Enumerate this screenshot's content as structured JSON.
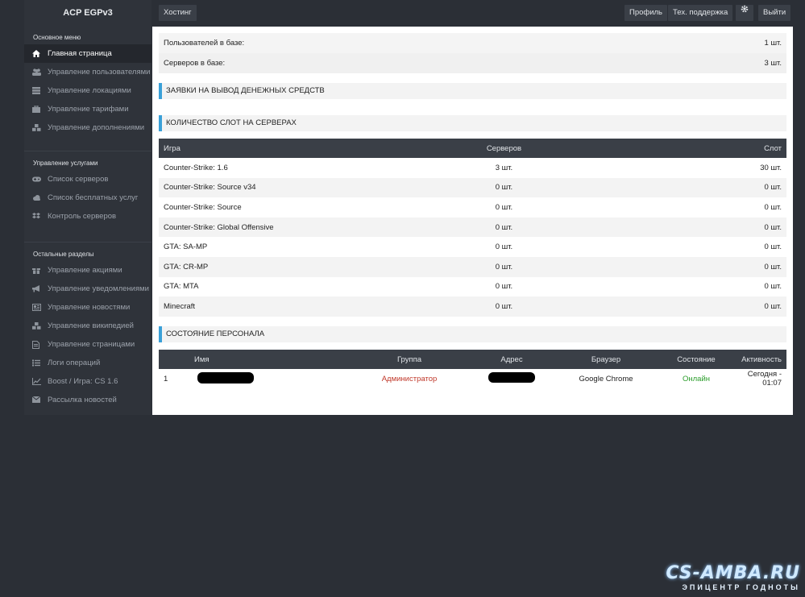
{
  "sidebar": {
    "brand": "ACP EGPv3",
    "sections": [
      {
        "title": "Основное меню",
        "items": [
          {
            "label": "Главная страница",
            "icon": "home-icon"
          },
          {
            "label": "Управление пользователями",
            "icon": "users-icon"
          },
          {
            "label": "Управление локациями",
            "icon": "server-rack-icon"
          },
          {
            "label": "Управление тарифами",
            "icon": "briefcase-icon"
          },
          {
            "label": "Управление дополнениями",
            "icon": "cubes-icon"
          }
        ]
      },
      {
        "title": "Управление услугами",
        "items": [
          {
            "label": "Список серверов",
            "icon": "gamepad-icon"
          },
          {
            "label": "Список бесплатных услуг",
            "icon": "cloud-icon"
          },
          {
            "label": "Контроль серверов",
            "icon": "dropbox-icon"
          }
        ]
      },
      {
        "title": "Остальные разделы",
        "items": [
          {
            "label": "Управление акциями",
            "icon": "gift-icon"
          },
          {
            "label": "Управление уведомлениями",
            "icon": "bullhorn-icon"
          },
          {
            "label": "Управление новостями",
            "icon": "newspaper-icon"
          },
          {
            "label": "Управление википедией",
            "icon": "cubes-icon"
          },
          {
            "label": "Управление страницами",
            "icon": "file-icon"
          },
          {
            "label": "Логи операций",
            "icon": "list-icon"
          },
          {
            "label": "Boost / Игра: CS 1.6",
            "icon": "line-chart-icon"
          },
          {
            "label": "Рассылка новостей",
            "icon": "mail-icon"
          }
        ]
      }
    ]
  },
  "topbar": {
    "hosting": "Хостинг",
    "profile": "Профиль",
    "support": "Тех. поддержка",
    "settings_icon": "gear-icon",
    "logout": "Выйти"
  },
  "stats": {
    "users_label": "Пользователей в базе:",
    "users_value": "1 шт.",
    "servers_label": "Серверов в базе:",
    "servers_value": "3 шт."
  },
  "headings": {
    "withdraw": "ЗАЯВКИ НА ВЫВОД ДЕНЕЖНЫХ СРЕДСТВ",
    "slots": "КОЛИЧЕСТВО СЛОТ НА СЕРВЕРАХ",
    "staff": "СОСТОЯНИЕ ПЕРСОНАЛА"
  },
  "slots_table": {
    "headers": {
      "game": "Игра",
      "servers": "Серверов",
      "slots": "Слот"
    },
    "rows": [
      {
        "game": "Counter-Strike: 1.6",
        "servers": "3 шт.",
        "slots": "30 шт."
      },
      {
        "game": "Counter-Strike: Source v34",
        "servers": "0 шт.",
        "slots": "0 шт."
      },
      {
        "game": "Counter-Strike: Source",
        "servers": "0 шт.",
        "slots": "0 шт."
      },
      {
        "game": "Counter-Strike: Global Offensive",
        "servers": "0 шт.",
        "slots": "0 шт."
      },
      {
        "game": "GTA: SA-MP",
        "servers": "0 шт.",
        "slots": "0 шт."
      },
      {
        "game": "GTA: CR-MP",
        "servers": "0 шт.",
        "slots": "0 шт."
      },
      {
        "game": "GTA: MTA",
        "servers": "0 шт.",
        "slots": "0 шт."
      },
      {
        "game": "Minecraft",
        "servers": "0 шт.",
        "slots": "0 шт."
      }
    ]
  },
  "staff_table": {
    "headers": {
      "id": "",
      "name": "Имя",
      "group": "Группа",
      "address": "Адрес",
      "browser": "Браузер",
      "state": "Состояние",
      "activity": "Активность"
    },
    "rows": [
      {
        "id": "1",
        "group": "Администратор",
        "browser": "Google Chrome",
        "state": "Онлайн",
        "activity": "Сегодня - 01:07"
      }
    ]
  },
  "watermark": {
    "logo": "CS-AMBA.RU",
    "tagline": "ЭПИЦЕНТР ГОДНОТЫ"
  },
  "colors": {
    "accent": "#3aa0d8",
    "sidebar_bg": "#2f333a",
    "page_bg": "#2b2f36",
    "admin_red": "#c0392b",
    "online_green": "#2a9d2a"
  }
}
